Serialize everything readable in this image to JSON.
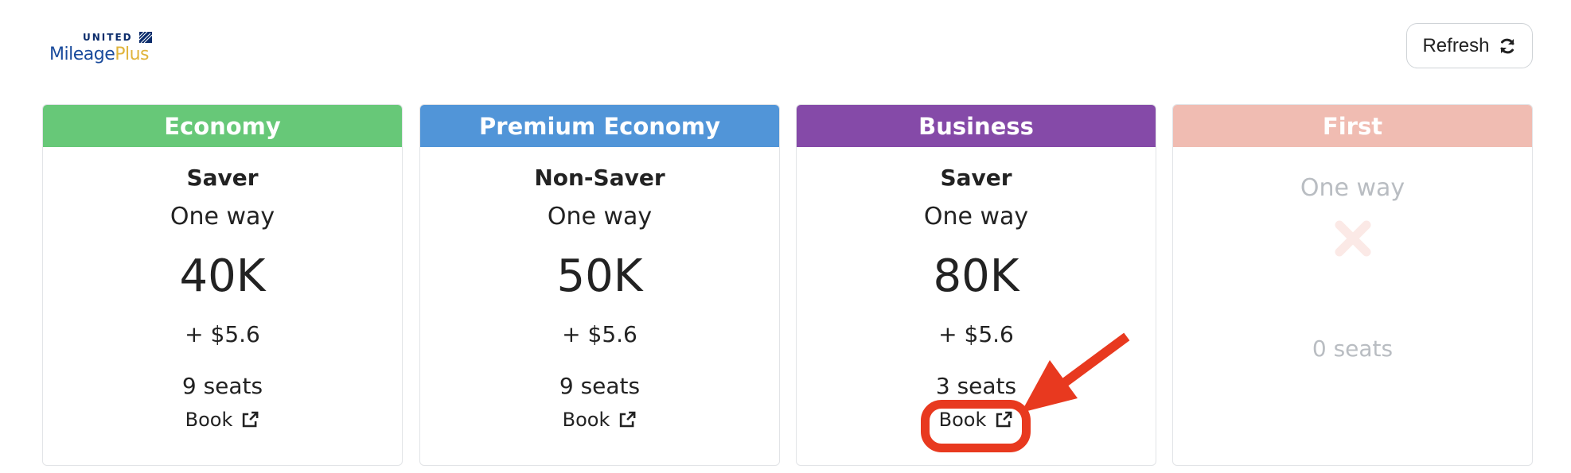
{
  "logo": {
    "top": "UNITED",
    "mileage": "Mileage",
    "plus": "Plus"
  },
  "refresh": {
    "label": "Refresh"
  },
  "cards": [
    {
      "cabin": "Economy",
      "header_color": "#67c878",
      "fare": "Saver",
      "trip": "One way",
      "miles": "40K",
      "tax": "+ $5.6",
      "seats": "9 seats",
      "book_label": "Book"
    },
    {
      "cabin": "Premium Economy",
      "header_color": "#5195d8",
      "fare": "Non-Saver",
      "trip": "One way",
      "miles": "50K",
      "tax": "+ $5.6",
      "seats": "9 seats",
      "book_label": "Book"
    },
    {
      "cabin": "Business",
      "header_color": "#854aa8",
      "fare": "Saver",
      "trip": "One way",
      "miles": "80K",
      "tax": "+ $5.6",
      "seats": "3 seats",
      "book_label": "Book"
    },
    {
      "cabin": "First",
      "header_color": "#f0bcb2",
      "trip": "One way",
      "seats": "0 seats",
      "unavailable": true
    }
  ],
  "colors": {
    "annotation": "#e8391f",
    "unavailable_text": "#b9bdc2",
    "unavailable_icon": "#fbe9e6"
  }
}
